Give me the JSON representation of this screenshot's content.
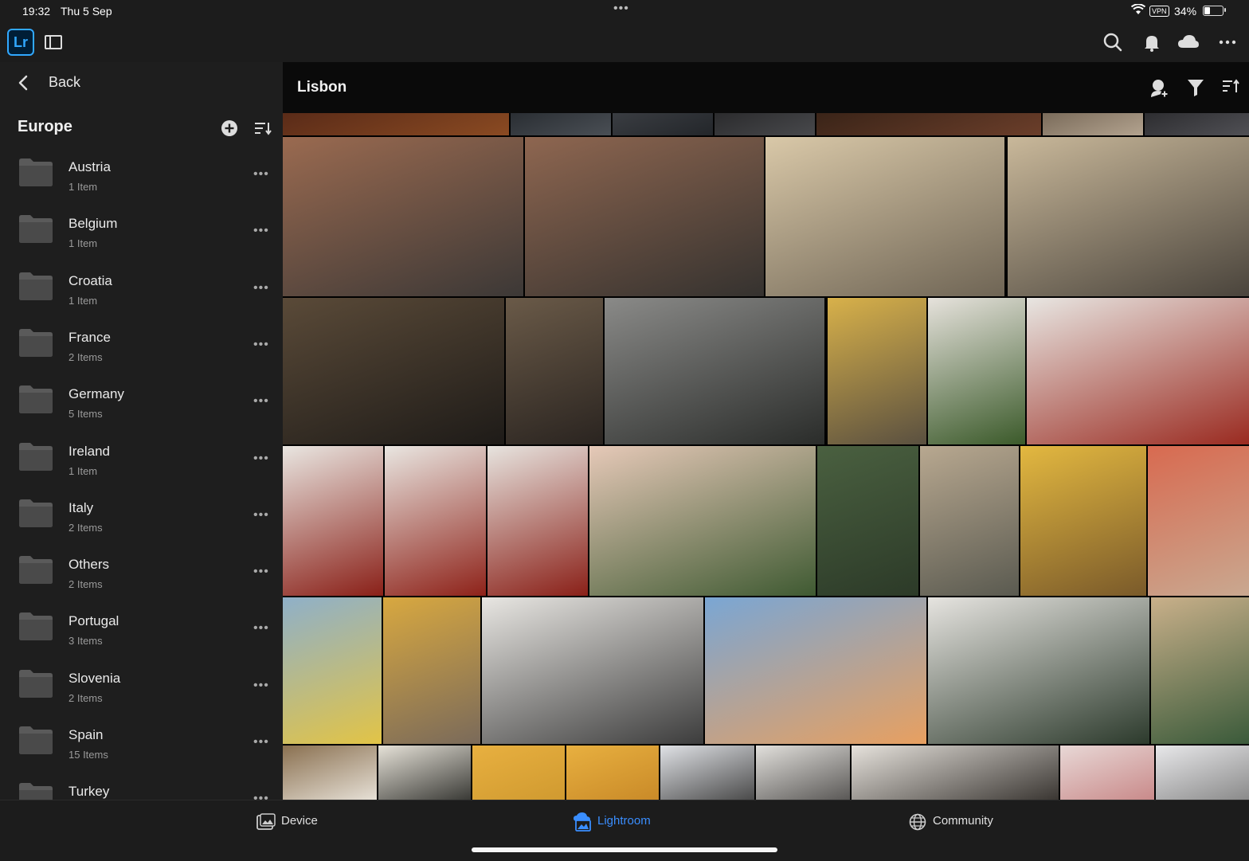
{
  "status_bar": {
    "time": "19:32",
    "date": "Thu 5 Sep",
    "more_dots": "•••",
    "vpn": "VPN",
    "battery_percent": "34%",
    "battery_level": 0.34
  },
  "app_bar": {
    "logo": "Lr",
    "icons": [
      "search-icon",
      "bell-icon",
      "cloud-icon",
      "more-icon"
    ]
  },
  "sidebar": {
    "back_label": "Back",
    "section_title": "Europe",
    "folders": [
      {
        "name": "Austria",
        "count": "1 Item"
      },
      {
        "name": "Belgium",
        "count": "1 Item"
      },
      {
        "name": "Croatia",
        "count": "1 Item"
      },
      {
        "name": "France",
        "count": "2 Items"
      },
      {
        "name": "Germany",
        "count": "5 Items"
      },
      {
        "name": "Ireland",
        "count": "1 Item"
      },
      {
        "name": "Italy",
        "count": "2 Items"
      },
      {
        "name": "Others",
        "count": "2 Items"
      },
      {
        "name": "Portugal",
        "count": "3 Items"
      },
      {
        "name": "Slovenia",
        "count": "2 Items"
      },
      {
        "name": "Spain",
        "count": "15 Items"
      },
      {
        "name": "Turkey",
        "count": ""
      }
    ],
    "more_label": "•••"
  },
  "main": {
    "album_title": "Lisbon",
    "header_icons": [
      "add-person-icon",
      "filter-icon",
      "sort-icon"
    ]
  },
  "bottom_tabs": [
    {
      "label": "Device",
      "icon": "device-photos-icon",
      "active": false
    },
    {
      "label": "Lightroom",
      "icon": "lightroom-cloud-icon",
      "active": true
    },
    {
      "label": "Community",
      "icon": "globe-icon",
      "active": false
    }
  ],
  "colors": {
    "accent": "#3a8eff",
    "background": "#141414",
    "sidebar": "#1e1e1e",
    "grid_bg": "#000000"
  }
}
